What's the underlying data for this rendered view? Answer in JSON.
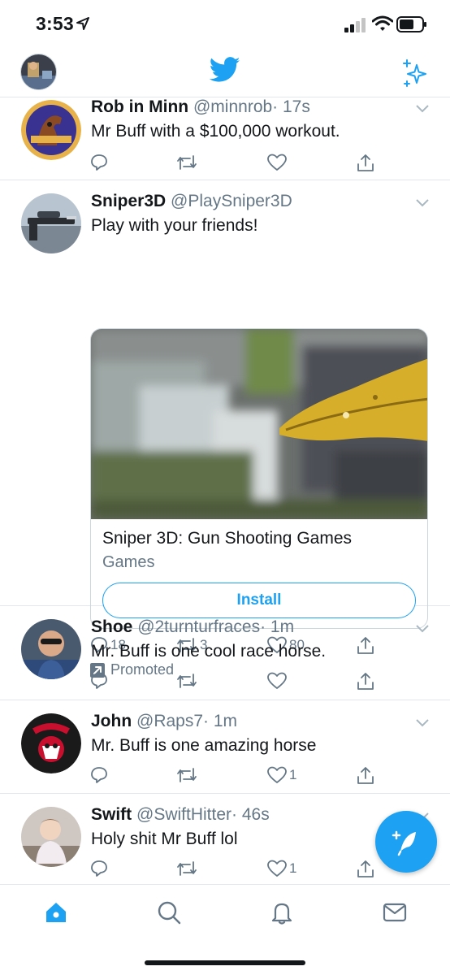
{
  "status_bar": {
    "time": "3:53"
  },
  "colors": {
    "accent": "#1da1f2",
    "text": "#14171a",
    "muted": "#657786",
    "divider": "#e1e8ed"
  },
  "tweets": [
    {
      "name": "Rob in Minn",
      "handle": "@minnrob",
      "time": "· 17s",
      "text": "Mr Buff with a $100,000 workout.",
      "replies": "",
      "retweets": "",
      "likes": ""
    },
    {
      "name": "Sniper3D",
      "handle": "@PlaySniper3D",
      "time": "",
      "text": "Play with your friends!",
      "replies": "18",
      "retweets": "3",
      "likes": "80",
      "card": {
        "title": "Sniper 3D: Gun Shooting Games",
        "subtitle": "Games",
        "button": "Install"
      },
      "promoted": "Promoted"
    },
    {
      "name": "Shoe",
      "handle": "@2turnturfraces",
      "time": "· 1m",
      "text": "Mr. Buff is one cool race horse.",
      "replies": "",
      "retweets": "",
      "likes": ""
    },
    {
      "name": "John",
      "handle": "@Raps7",
      "time": "· 1m",
      "text": "Mr. Buff is one amazing horse",
      "replies": "",
      "retweets": "",
      "likes": "1"
    },
    {
      "name": "Swift",
      "handle": "@SwiftHitter",
      "time": "· 46s",
      "text": "Holy shit Mr Buff lol",
      "replies": "",
      "retweets": "",
      "likes": "1"
    }
  ],
  "tab_bar": {
    "icons": [
      "home-icon",
      "search-icon",
      "notifications-icon",
      "messages-icon"
    ]
  }
}
